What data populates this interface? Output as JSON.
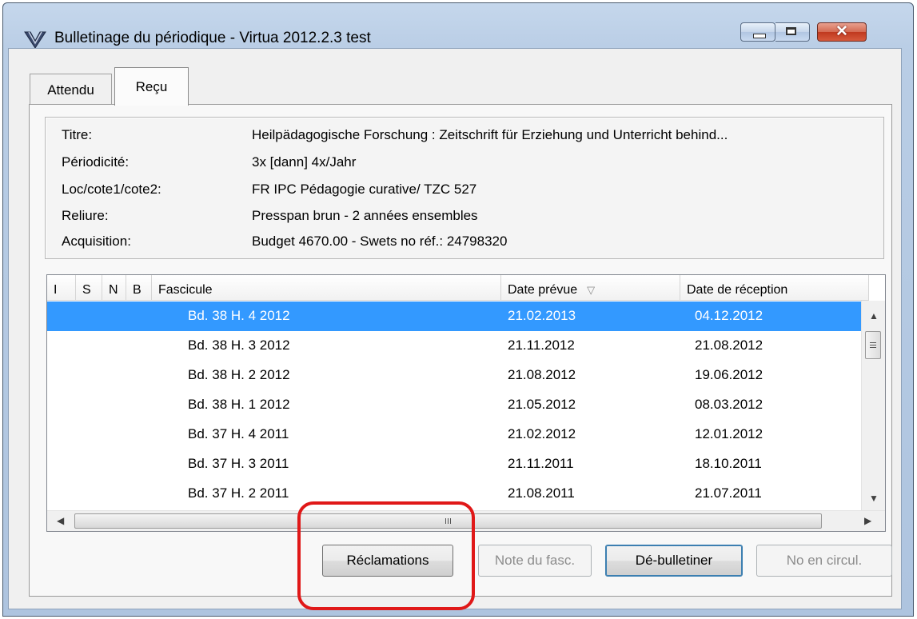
{
  "window": {
    "title": "Bulletinage du périodique - Virtua 2012.2.3 test",
    "app_icon": "virtua-v-icon",
    "controls": {
      "close_glyph": "✕"
    }
  },
  "tabs": [
    {
      "label": "Attendu",
      "active": false
    },
    {
      "label": "Reçu",
      "active": true
    }
  ],
  "info": [
    {
      "label": "Titre:",
      "value": "Heilpädagogische Forschung : Zeitschrift für Erziehung und Unterricht behind..."
    },
    {
      "label": "Périodicité:",
      "value": "3x [dann] 4x/Jahr"
    },
    {
      "label": "Loc/cote1/cote2:",
      "value": "FR IPC Pédagogie curative/ TZC 527"
    },
    {
      "label": "Reliure:",
      "value": "Presspan brun - 2 années ensembles"
    },
    {
      "label": "Acquisition:",
      "value": "Budget 4670.00 - Swets no réf.: 24798320"
    }
  ],
  "table": {
    "columns": [
      "I",
      "S",
      "N",
      "B",
      "Fascicule",
      "Date prévue",
      "Date de réception"
    ],
    "sort_indicator": "▽",
    "rows": [
      {
        "fascicule": "Bd. 38 H. 4  2012",
        "date_prevue": "21.02.2013",
        "date_reception": "04.12.2012",
        "selected": true
      },
      {
        "fascicule": "Bd. 38 H. 3  2012",
        "date_prevue": "21.11.2012",
        "date_reception": "21.08.2012"
      },
      {
        "fascicule": "Bd. 38 H. 2  2012",
        "date_prevue": "21.08.2012",
        "date_reception": "19.06.2012"
      },
      {
        "fascicule": "Bd. 38 H. 1  2012",
        "date_prevue": "21.05.2012",
        "date_reception": "08.03.2012"
      },
      {
        "fascicule": "Bd. 37 H. 4  2011",
        "date_prevue": "21.02.2012",
        "date_reception": "12.01.2012"
      },
      {
        "fascicule": "Bd. 37 H. 3  2011",
        "date_prevue": "21.11.2011",
        "date_reception": "18.10.2011"
      },
      {
        "fascicule": "Bd. 37 H. 2  2011",
        "date_prevue": "21.08.2011",
        "date_reception": "21.07.2011"
      }
    ]
  },
  "buttons": {
    "reclamations": "Réclamations",
    "note_fasc": "Note du fasc.",
    "de_bulletiner": "Dé-bulletiner",
    "no_circul": "No en circul."
  },
  "colors": {
    "selection": "#3399ff",
    "annotation": "#e01818"
  }
}
